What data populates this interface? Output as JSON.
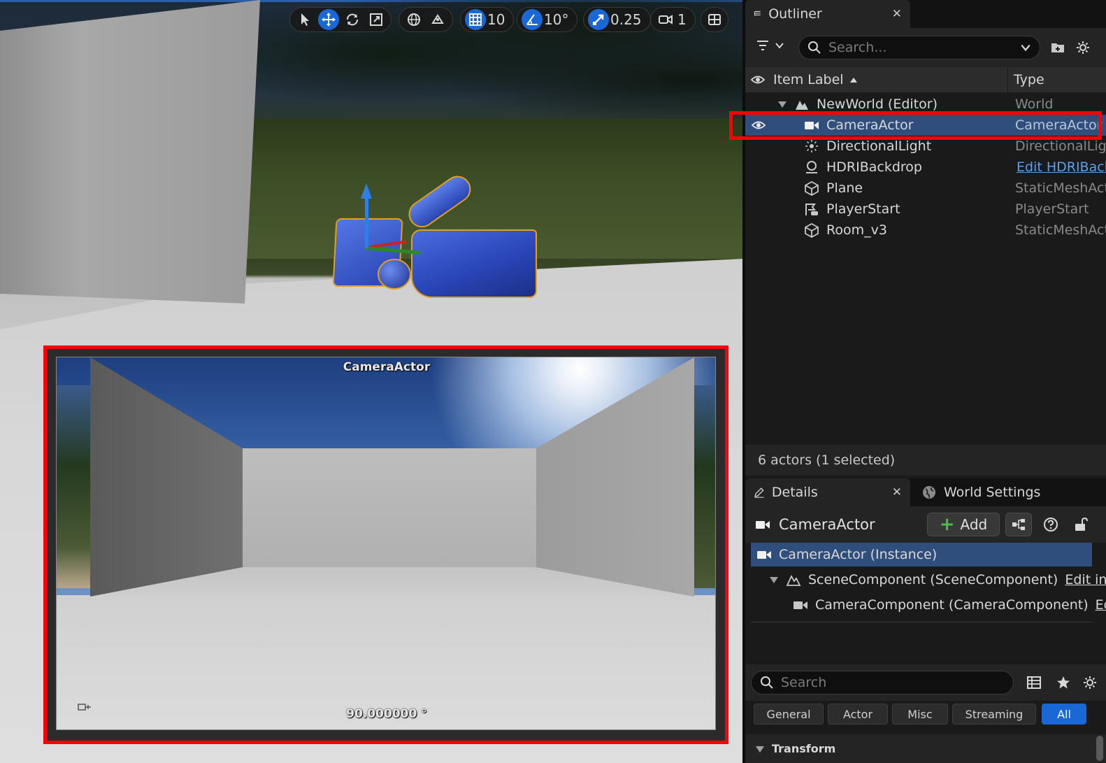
{
  "toolbar": {
    "grid_snap_value": "10",
    "rotation_snap_value": "10°",
    "scale_snap_value": "0.25",
    "camera_speed_value": "1"
  },
  "viewport": {
    "preview_title": "CameraActor",
    "preview_fov": "90.000000 °"
  },
  "outliner": {
    "tab_label": "Outliner",
    "search_placeholder": "Search...",
    "col_label": "Item Label",
    "col_type": "Type",
    "rows": [
      {
        "label": "NewWorld (Editor)",
        "type": "World"
      },
      {
        "label": "CameraActor",
        "type": "CameraActor"
      },
      {
        "label": "DirectionalLight",
        "type": "DirectionalLight"
      },
      {
        "label": "HDRIBackdrop",
        "type": "Edit HDRIBackdrop"
      },
      {
        "label": "Plane",
        "type": "StaticMeshActor"
      },
      {
        "label": "PlayerStart",
        "type": "PlayerStart"
      },
      {
        "label": "Room_v3",
        "type": "StaticMeshActor"
      }
    ],
    "status": "6 actors (1 selected)"
  },
  "details": {
    "tab_label": "Details",
    "world_settings_label": "World Settings",
    "actor_name": "CameraActor",
    "add_label": "Add",
    "components": [
      {
        "label": "CameraActor (Instance)",
        "edit": ""
      },
      {
        "label": "SceneComponent (SceneComponent)",
        "edit": "Edit in C"
      },
      {
        "label": "CameraComponent (CameraComponent)",
        "edit": "Edi"
      }
    ],
    "search_placeholder": "Search",
    "filters": [
      "General",
      "Actor",
      "Misc",
      "Streaming",
      "All"
    ],
    "section_transform": "Transform"
  },
  "colors": {
    "accent": "#1a68d6",
    "selection": "#2f4e7c",
    "highlight": "#ff0000"
  }
}
